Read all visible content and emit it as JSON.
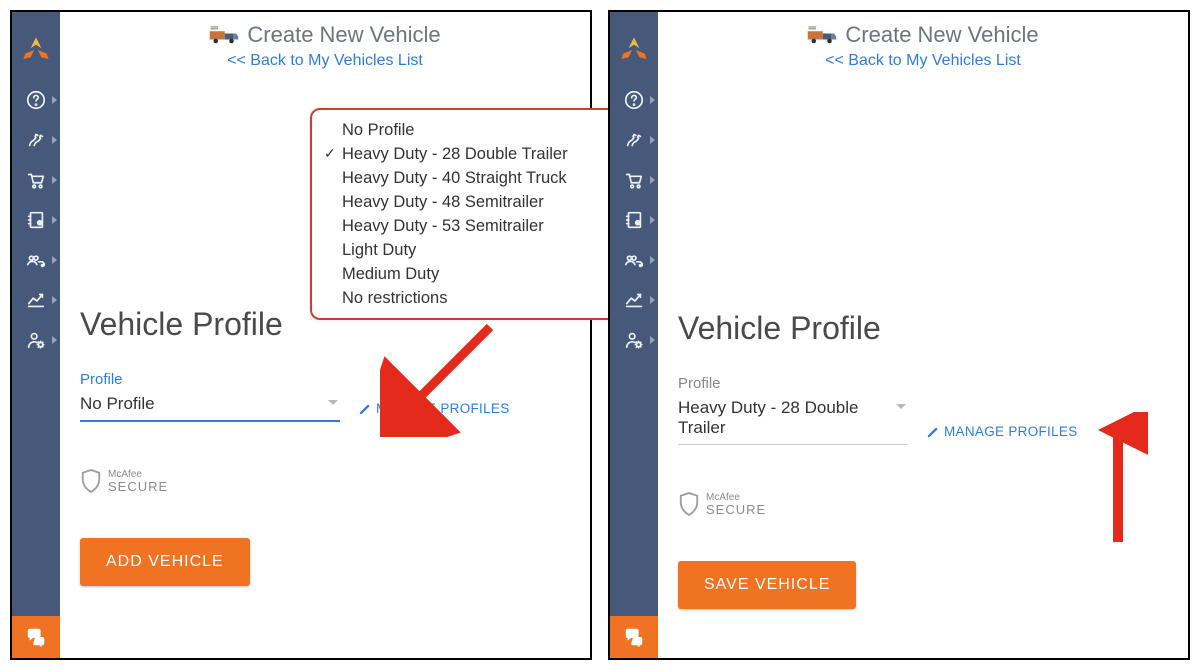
{
  "header": {
    "title": "Create New Vehicle",
    "back_link": "<< Back to My Vehicles List"
  },
  "section_title": "Vehicle Profile",
  "field_label": "Profile",
  "manage_link": "MANAGE PROFILES",
  "mcafee": {
    "line1": "McAfee",
    "line2": "SECURE"
  },
  "left_panel": {
    "select_value": "No Profile",
    "button_label": "ADD VEHICLE",
    "dropdown": {
      "options": [
        {
          "label": "No Profile",
          "checked": false
        },
        {
          "label": "Heavy Duty - 28 Double Trailer",
          "checked": true
        },
        {
          "label": "Heavy Duty - 40 Straight Truck",
          "checked": false
        },
        {
          "label": "Heavy Duty - 48 Semitrailer",
          "checked": false
        },
        {
          "label": "Heavy Duty - 53 Semitrailer",
          "checked": false
        },
        {
          "label": "Light Duty",
          "checked": false
        },
        {
          "label": "Medium Duty",
          "checked": false
        },
        {
          "label": "No restrictions",
          "checked": false
        }
      ]
    }
  },
  "right_panel": {
    "select_value": "Heavy Duty - 28 Double Trailer",
    "button_label": "SAVE VEHICLE"
  }
}
